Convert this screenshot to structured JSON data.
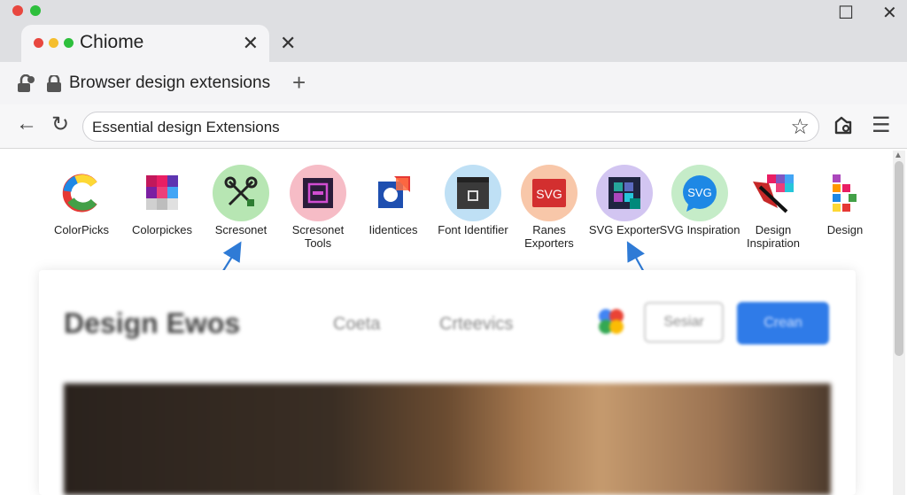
{
  "window": {
    "colors": {
      "red": "#e8473f",
      "yellow": "#f5be2e",
      "green": "#2dbf3c"
    },
    "maximize_glyph": "☐",
    "close_glyph": "✕"
  },
  "tab": {
    "title": "Chiome",
    "close_glyph": "✕"
  },
  "newtab_close_glyph": "✕",
  "bookmark_bar": {
    "title": "Browser design extensions",
    "plus_glyph": "+"
  },
  "address_bar": {
    "back_glyph": "←",
    "reload_glyph": "↻",
    "url": "Essential design Extensions",
    "star_glyph": "☆",
    "menu_glyph": "☰"
  },
  "extensions": [
    {
      "label": "ColorPicks",
      "icon": "colorpicks-c-icon",
      "halo": "none"
    },
    {
      "label": "Colorpickes",
      "icon": "color-grid-icon",
      "halo": "none"
    },
    {
      "label": "Scresonet",
      "icon": "scissors-tools-icon",
      "halo": "#b7e6b3"
    },
    {
      "label": "Scresonet\nTools",
      "icon": "screenshot-frame-icon",
      "halo": "#f6bcc6"
    },
    {
      "label": "Iidentices",
      "icon": "identifier-icon",
      "halo": "none"
    },
    {
      "label": "Font Identifier",
      "icon": "font-window-icon",
      "halo": "#bfe0f5"
    },
    {
      "label": "Ranes\nExporters",
      "icon": "svg-badge-icon",
      "halo": "#f8c7a9"
    },
    {
      "label": "SVG Exporter",
      "icon": "svg-exporter-icon",
      "halo": "#d2c5f1"
    },
    {
      "label": "SVG Inspiration",
      "icon": "svg-bubble-icon",
      "halo": "#c5ecc8"
    },
    {
      "label": "Design\nInspiration",
      "icon": "design-inspiration-icon",
      "halo": "none"
    },
    {
      "label": "Design",
      "icon": "design-blocks-icon",
      "halo": "none"
    }
  ],
  "card": {
    "title": "Design Ewos",
    "nav": [
      "Coeta",
      "Crteevics"
    ],
    "button_outline": "Sesiar",
    "button_solid": "Crean"
  }
}
